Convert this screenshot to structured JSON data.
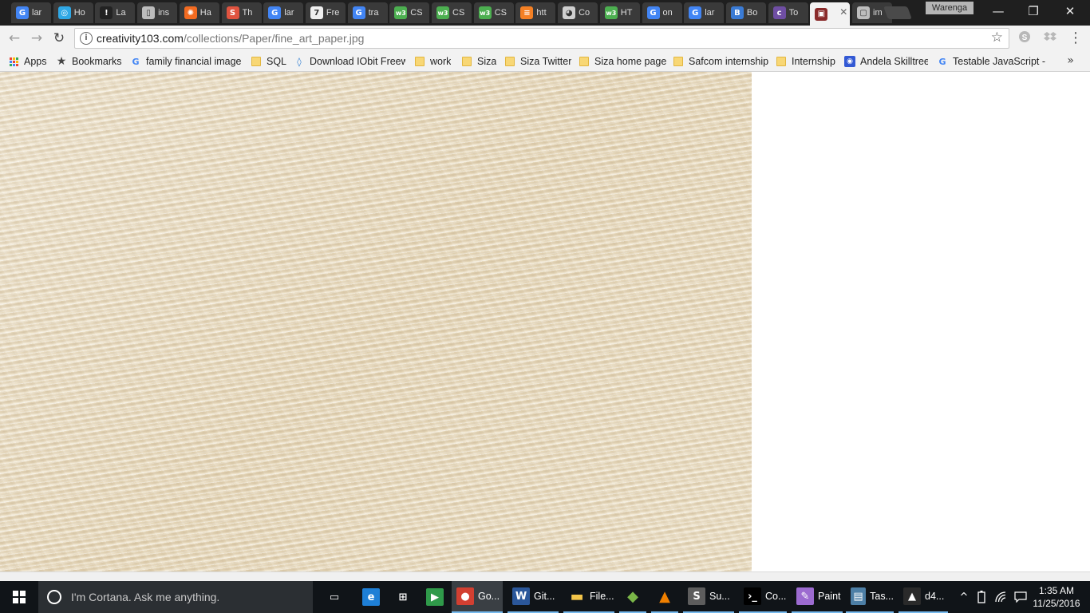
{
  "browser": {
    "tabs": [
      {
        "title": "lar",
        "icon": "google-icon",
        "color": "#4285f4"
      },
      {
        "title": "Ho",
        "icon": "compass-icon",
        "color": "#2fa8e6"
      },
      {
        "title": "La",
        "icon": "exclamation-icon",
        "color": "#222222"
      },
      {
        "title": "ins",
        "icon": "book-icon",
        "color": "#bdbdbd"
      },
      {
        "title": "Ha",
        "icon": "sunburst-icon",
        "color": "#f36b21"
      },
      {
        "title": "Th",
        "icon": "s-logo-icon",
        "color": "#e0533f"
      },
      {
        "title": "lar",
        "icon": "google-icon",
        "color": "#4285f4"
      },
      {
        "title": "Fre",
        "icon": "tw-logo-icon",
        "color": "#efefef"
      },
      {
        "title": "tra",
        "icon": "google-icon",
        "color": "#4285f4"
      },
      {
        "title": "CS",
        "icon": "w3-icon",
        "color": "#4caf50"
      },
      {
        "title": "CS",
        "icon": "w3-icon",
        "color": "#4caf50"
      },
      {
        "title": "CS",
        "icon": "w3-icon",
        "color": "#4caf50"
      },
      {
        "title": "htt",
        "icon": "stack-overflow-icon",
        "color": "#f48024"
      },
      {
        "title": "Co",
        "icon": "palette-icon",
        "color": "#cfcfcf"
      },
      {
        "title": "HT",
        "icon": "w3-icon",
        "color": "#4caf50"
      },
      {
        "title": "on",
        "icon": "google-icon",
        "color": "#4285f4"
      },
      {
        "title": "lar",
        "icon": "google-icon",
        "color": "#4285f4"
      },
      {
        "title": "Bo",
        "icon": "bootstrap-icon",
        "color": "#3a7bd5"
      },
      {
        "title": "To",
        "icon": "coderbyte-icon",
        "color": "#6f4ea3"
      },
      {
        "title": "",
        "icon": "image-thumb-icon",
        "color": "#8a2b2b",
        "active": true
      },
      {
        "title": "im",
        "icon": "page-icon",
        "color": "#bdbdbd"
      }
    ],
    "profile_name": "Warenga",
    "window_controls": {
      "minimize": "—",
      "restore": "❐",
      "close": "✕"
    },
    "nav": {
      "back": "←",
      "forward": "→",
      "reload": "↻"
    },
    "omnibox": {
      "host": "creativity103.com",
      "path": "/collections/Paper/fine_art_paper.jpg",
      "info": "i",
      "star": "☆"
    },
    "extensions": [
      "skype-icon",
      "dropbox-icon"
    ],
    "menu": "⋮"
  },
  "bookmarks": [
    {
      "label": "Apps",
      "icon": "apps-grid-icon"
    },
    {
      "label": "Bookmarks",
      "icon": "star-icon"
    },
    {
      "label": "family financial image",
      "icon": "google-icon"
    },
    {
      "label": "SQL",
      "icon": "folder-icon"
    },
    {
      "label": "Download IObit Freew",
      "icon": "iobit-icon"
    },
    {
      "label": "work",
      "icon": "folder-icon"
    },
    {
      "label": "Siza",
      "icon": "folder-icon"
    },
    {
      "label": "Siza Twitter",
      "icon": "folder-icon"
    },
    {
      "label": "Siza home page",
      "icon": "folder-icon"
    },
    {
      "label": "Safcom internship",
      "icon": "folder-icon"
    },
    {
      "label": "Internship",
      "icon": "folder-icon"
    },
    {
      "label": "Andela Skilltree",
      "icon": "andela-icon"
    },
    {
      "label": "Testable JavaScript - N",
      "icon": "google-icon"
    }
  ],
  "bookmarks_overflow": "»",
  "content": {
    "image_description": "fine art paper texture",
    "paper_color": "#ece0c6"
  },
  "taskbar": {
    "cortana_placeholder": "I'm Cortana. Ask me anything.",
    "pinned": [
      {
        "label": "",
        "icon": "task-view-icon"
      },
      {
        "label": "",
        "icon": "edge-icon"
      },
      {
        "label": "",
        "icon": "store-icon"
      },
      {
        "label": "",
        "icon": "media-player-icon"
      }
    ],
    "apps": [
      {
        "label": "Go...",
        "icon": "chrome-icon",
        "active": true
      },
      {
        "label": "Git...",
        "icon": "word-icon"
      },
      {
        "label": "File...",
        "icon": "file-explorer-icon"
      },
      {
        "label": "",
        "icon": "sync-icon"
      },
      {
        "label": "",
        "icon": "vlc-icon"
      },
      {
        "label": "Su...",
        "icon": "sublime-icon"
      },
      {
        "label": "Co...",
        "icon": "terminal-icon"
      },
      {
        "label": "Paint",
        "icon": "paint-icon"
      },
      {
        "label": "Tas...",
        "icon": "task-manager-icon"
      },
      {
        "label": "d4...",
        "icon": "photos-icon"
      }
    ],
    "tray": [
      "chevron-up-icon",
      "battery-icon",
      "wifi-icon",
      "notification-icon"
    ],
    "time": "1:35 AM",
    "date": "11/25/2016"
  }
}
